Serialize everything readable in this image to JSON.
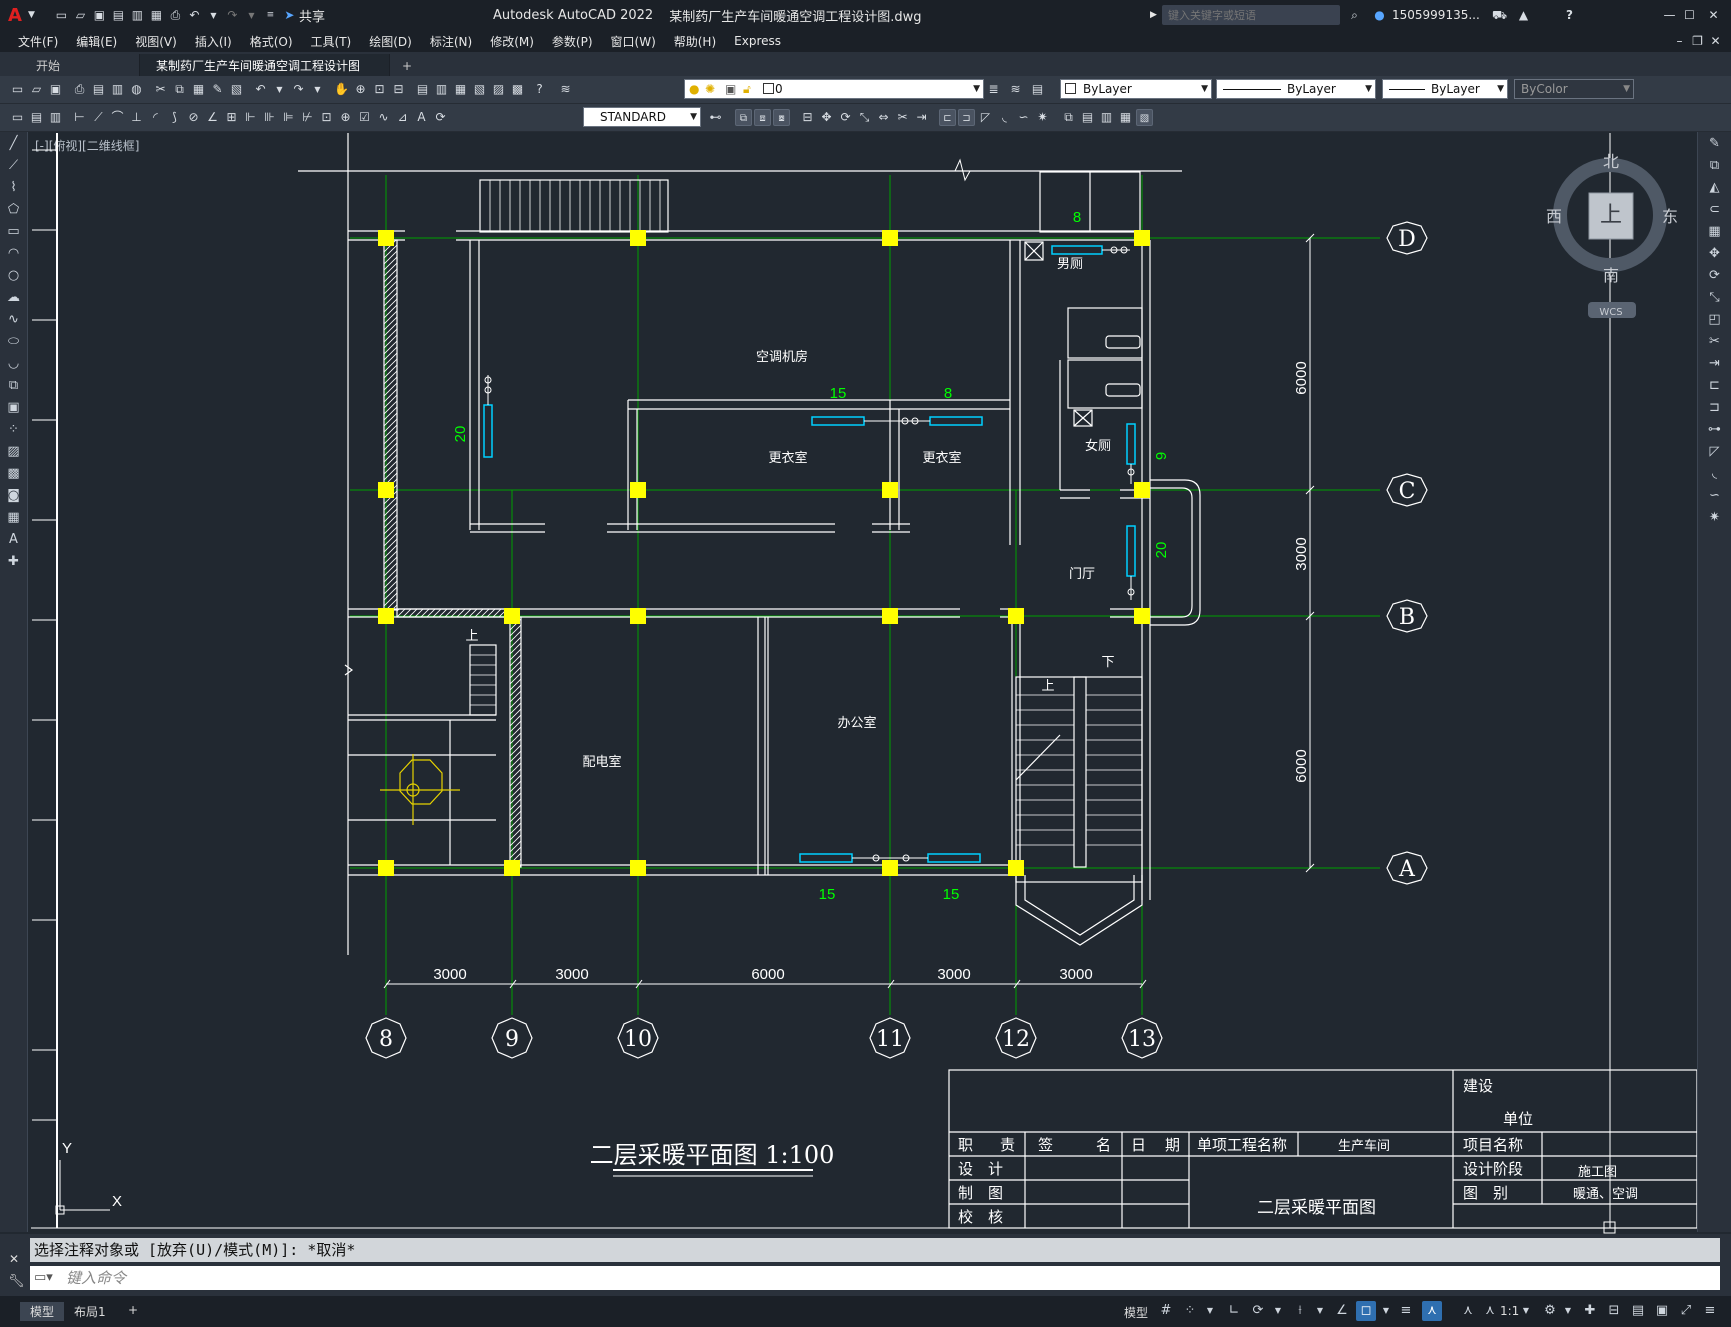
{
  "app": {
    "title": "Autodesk AutoCAD 2022",
    "filename": "某制药厂生产车间暖通空调工程设计图.dwg",
    "share_label": "共享",
    "search_placeholder": "键入关键字或短语",
    "user": "1505999135...",
    "help": "?"
  },
  "menu": [
    "文件(F)",
    "编辑(E)",
    "视图(V)",
    "插入(I)",
    "格式(O)",
    "工具(T)",
    "绘图(D)",
    "标注(N)",
    "修改(M)",
    "参数(P)",
    "窗口(W)",
    "帮助(H)",
    "Express"
  ],
  "tabs": [
    {
      "label": "开始"
    },
    {
      "label": "某制药厂生产车间暖通空调工程设计图*"
    }
  ],
  "toolbar": {
    "layer_value": "0",
    "color_value": "ByLayer",
    "linetype_value": "ByLayer",
    "lineweight_value": "ByLayer",
    "plotstyle_value": "ByColor",
    "textstyle_value": "STANDARD"
  },
  "viewport": {
    "label": "[-][俯视][二维线框]"
  },
  "viewcube": {
    "north": "北",
    "south": "南",
    "east": "东",
    "west": "西",
    "top": "上",
    "wcs": "WCS"
  },
  "drawing": {
    "rooms": [
      "空调机房",
      "更衣室",
      "更衣室",
      "男厕",
      "女厕",
      "门厅",
      "配电室",
      "办公室"
    ],
    "up_labels": [
      "上",
      "上",
      "下"
    ],
    "axes_letters": [
      "D",
      "C",
      "B",
      "A"
    ],
    "axes_numbers": [
      "8",
      "9",
      "10",
      "11",
      "12",
      "13"
    ],
    "bottom_dims": [
      "3000",
      "3000",
      "6000",
      "3000",
      "3000"
    ],
    "side_dims": [
      "6000",
      "3000",
      "6000"
    ],
    "radiator_labels": [
      "8",
      "15",
      "8",
      "20",
      "9",
      "20",
      "15",
      "15"
    ],
    "title": "二层采暖平面图 1:100",
    "ucs_y": "Y",
    "ucs_x": "X"
  },
  "titleblock": {
    "jianshe": "建设",
    "danwei": "单位",
    "headers": [
      "职",
      "责",
      "签",
      "名",
      "日",
      "期"
    ],
    "project_label": "单项工程名称",
    "project_value": "生产车间",
    "item_label": "项目名称",
    "stage_label": "设计阶段",
    "stage_value": "施工图",
    "type_label": "图　别",
    "type_value": "暖通、空调",
    "drawing_name": "二层采暖平面图",
    "rows": [
      "设　计",
      "制　图",
      "校　核"
    ]
  },
  "command": {
    "history": "选择注释对象或 [放弃(U)/模式(M)]: *取消*",
    "placeholder": "键入命令"
  },
  "status": {
    "model": "模型",
    "layout": "布局1",
    "model_label": "模型",
    "scale": "1:1"
  },
  "colors": {
    "background": "#212830",
    "wall": "#ffffff",
    "axis": "#00a000",
    "column": "#ffff00",
    "radiator": "#00d0ff",
    "dim_text": "#00ff00"
  }
}
